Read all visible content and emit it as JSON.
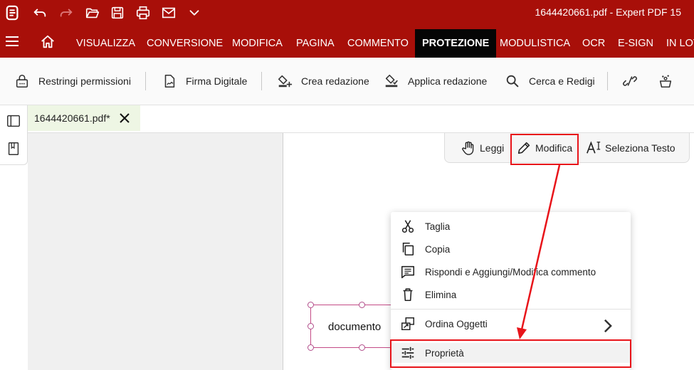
{
  "titlebar": {
    "filename": "1644420661.pdf",
    "app_name": "Expert PDF 15",
    "separator": " - ",
    "bg_color": "#a80f09"
  },
  "quick_access": {
    "icons": [
      "app-logo-icon",
      "undo-icon",
      "redo-icon",
      "open-folder-icon",
      "save-icon",
      "print-icon",
      "email-icon",
      "chevron-down-icon"
    ]
  },
  "menu": {
    "tabs": [
      {
        "label": "VISUALIZZA"
      },
      {
        "label": "CONVERSIONE"
      },
      {
        "label": "MODIFICA"
      },
      {
        "label": "PAGINA"
      },
      {
        "label": "COMMENTO"
      },
      {
        "label": "PROTEZIONE",
        "active": true
      },
      {
        "label": "MODULISTICA"
      },
      {
        "label": "OCR"
      },
      {
        "label": "E-SIGN"
      },
      {
        "label": "IN LOTTI"
      }
    ]
  },
  "ribbon": {
    "restrict": "Restringi permissioni",
    "digital_signature": "Firma Digitale",
    "create_redaction": "Crea redazione",
    "apply_redaction": "Applica redazione",
    "search_redact": "Cerca e Redigi"
  },
  "document_tab": {
    "label": "1644420661.pdf*"
  },
  "mode_toolbar": {
    "read": "Leggi",
    "edit": "Modifica",
    "select_text": "Seleziona Testo"
  },
  "textbox": {
    "text": "documento"
  },
  "context_menu": {
    "items": [
      {
        "label": "Taglia",
        "icon": "scissors-icon"
      },
      {
        "label": "Copia",
        "icon": "copy-icon"
      },
      {
        "label": "Rispondi e Aggiungi/Modifica commento",
        "icon": "comment-icon"
      },
      {
        "label": "Elimina",
        "icon": "trash-icon"
      },
      {
        "label": "Ordina Oggetti",
        "icon": "arrange-objects-icon",
        "submenu": true
      },
      {
        "label": "Proprietà",
        "icon": "properties-icon",
        "hover": true
      }
    ]
  },
  "annotations": {
    "highlight_color": "#e8141a"
  }
}
